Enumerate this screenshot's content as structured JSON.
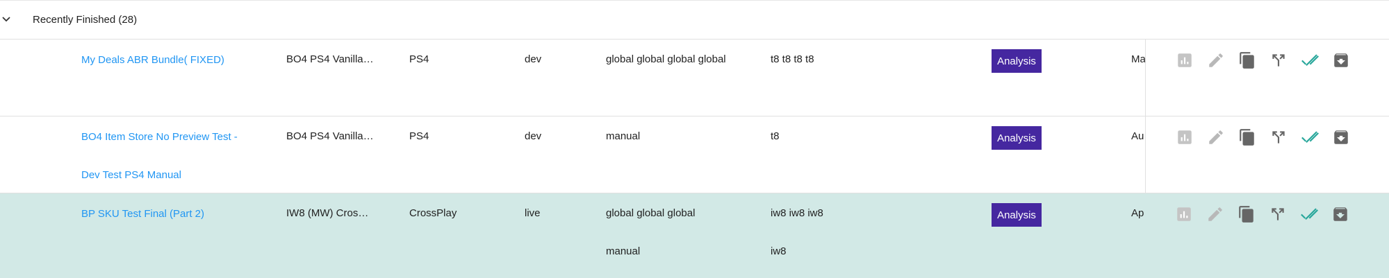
{
  "group": {
    "title": "Recently Finished (28)"
  },
  "rows": [
    {
      "name": "My Deals ABR Bundle( FIXED)",
      "name_line2": "",
      "game": "BO4 PS4 Vanilla…",
      "platform": "PS4",
      "env": "dev",
      "region": "global global global global",
      "region_line2": "",
      "title_code": "t8 t8 t8 t8",
      "title_code_line2": "",
      "status": "Analysis",
      "truncated": "Ma",
      "selected": false
    },
    {
      "name": "BO4 Item Store No Preview Test -",
      "name_line2": "Dev Test PS4 Manual",
      "game": "BO4 PS4 Vanilla…",
      "platform": "PS4",
      "env": "dev",
      "region": "manual",
      "region_line2": "",
      "title_code": "t8",
      "title_code_line2": "",
      "status": "Analysis",
      "truncated": "Au",
      "selected": false
    },
    {
      "name": "BP SKU Test Final (Part 2)",
      "name_line2": "",
      "game": "IW8 (MW) Cros…",
      "platform": "CrossPlay",
      "env": "live",
      "region": "global global global",
      "region_line2": "manual",
      "title_code": "iw8 iw8 iw8",
      "title_code_line2": "iw8",
      "status": "Analysis",
      "truncated": "Ap",
      "selected": true
    }
  ],
  "actions": [
    {
      "icon": "bar-chart-icon",
      "color": "#c4c4c4"
    },
    {
      "icon": "edit-pencil-icon",
      "color": "#b8b8b8"
    },
    {
      "icon": "copy-icon",
      "color": "#666666"
    },
    {
      "icon": "merge-arrow-icon",
      "color": "#666666"
    },
    {
      "icon": "double-check-icon",
      "color": "#26a69a"
    },
    {
      "icon": "archive-icon",
      "color": "#666666"
    }
  ],
  "colors": {
    "link": "#2196f3",
    "status_badge": "#4527a0",
    "selected_row": "#d2e9e6",
    "check": "#26a69a"
  }
}
